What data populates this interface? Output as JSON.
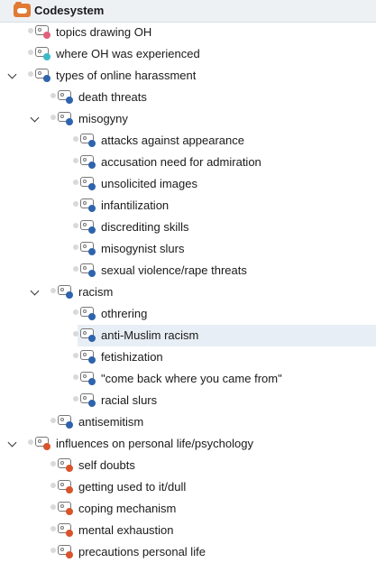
{
  "header": {
    "title": "Codesystem",
    "icon": "codesystem-icon"
  },
  "colors": {
    "blue": "#2e64ad",
    "pink": "#e0607a",
    "teal": "#3cb8c8",
    "red": "#d9542b"
  },
  "tree": [
    {
      "label": "topics drawing OH",
      "level": 0,
      "color": "#e0607a",
      "expanded": null
    },
    {
      "label": "where OH was experienced",
      "level": 0,
      "color": "#3cb8c8",
      "expanded": null
    },
    {
      "label": "types of online harassment",
      "level": 0,
      "color": "#2e64ad",
      "expanded": true
    },
    {
      "label": "death threats",
      "level": 1,
      "color": "#2e64ad",
      "expanded": null
    },
    {
      "label": "misogyny",
      "level": 1,
      "color": "#2e64ad",
      "expanded": true
    },
    {
      "label": "attacks against appearance",
      "level": 2,
      "color": "#2e64ad",
      "expanded": null
    },
    {
      "label": "accusation need for admiration",
      "level": 2,
      "color": "#2e64ad",
      "expanded": null
    },
    {
      "label": "unsolicited images",
      "level": 2,
      "color": "#2e64ad",
      "expanded": null
    },
    {
      "label": "infantilization",
      "level": 2,
      "color": "#2e64ad",
      "expanded": null
    },
    {
      "label": "discrediting skills",
      "level": 2,
      "color": "#2e64ad",
      "expanded": null
    },
    {
      "label": "misogynist slurs",
      "level": 2,
      "color": "#2e64ad",
      "expanded": null
    },
    {
      "label": "sexual violence/rape threats",
      "level": 2,
      "color": "#2e64ad",
      "expanded": null
    },
    {
      "label": "racism",
      "level": 1,
      "color": "#2e64ad",
      "expanded": true
    },
    {
      "label": "othrering",
      "level": 2,
      "color": "#2e64ad",
      "expanded": null
    },
    {
      "label": "anti-Muslim racism",
      "level": 2,
      "color": "#2e64ad",
      "expanded": null,
      "selected": true
    },
    {
      "label": "fetishization",
      "level": 2,
      "color": "#2e64ad",
      "expanded": null
    },
    {
      "label": "\"come back where you came from\"",
      "level": 2,
      "color": "#2e64ad",
      "expanded": null
    },
    {
      "label": "racial slurs",
      "level": 2,
      "color": "#2e64ad",
      "expanded": null
    },
    {
      "label": "antisemitism",
      "level": 1,
      "color": "#2e64ad",
      "expanded": null
    },
    {
      "label": "influences on personal life/psychology",
      "level": 0,
      "color": "#d9542b",
      "expanded": true
    },
    {
      "label": "self doubts",
      "level": 1,
      "color": "#d9542b",
      "expanded": null
    },
    {
      "label": "getting used to it/dull",
      "level": 1,
      "color": "#d9542b",
      "expanded": null
    },
    {
      "label": "coping mechanism",
      "level": 1,
      "color": "#d9542b",
      "expanded": null
    },
    {
      "label": "mental exhaustion",
      "level": 1,
      "color": "#d9542b",
      "expanded": null
    },
    {
      "label": "precautions personal life",
      "level": 1,
      "color": "#d9542b",
      "expanded": null
    }
  ]
}
